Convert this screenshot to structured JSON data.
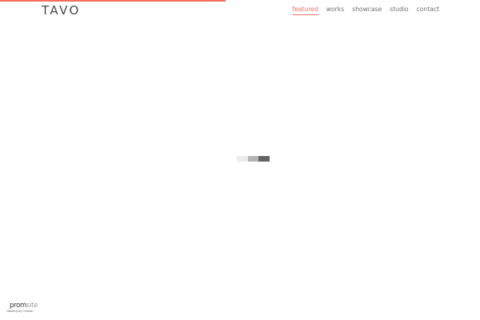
{
  "header": {
    "logo": "TAVO",
    "loading_progress_percent": 47,
    "nav": [
      {
        "label": "featured",
        "active": true
      },
      {
        "label": "works",
        "active": false
      },
      {
        "label": "showcase",
        "active": false
      },
      {
        "label": "studio",
        "active": false
      },
      {
        "label": "contact",
        "active": false
      }
    ]
  },
  "loader": {
    "block_colors": [
      "#ececec",
      "#b4b4b4",
      "#636363"
    ]
  },
  "footer": {
    "badge_prefix": "prom",
    "badge_suffix": "site",
    "badge_sub": "Hosting by CDmon"
  },
  "colors": {
    "accent": "#f26f61",
    "text": "#4a4a4a",
    "background": "#ffffff"
  }
}
